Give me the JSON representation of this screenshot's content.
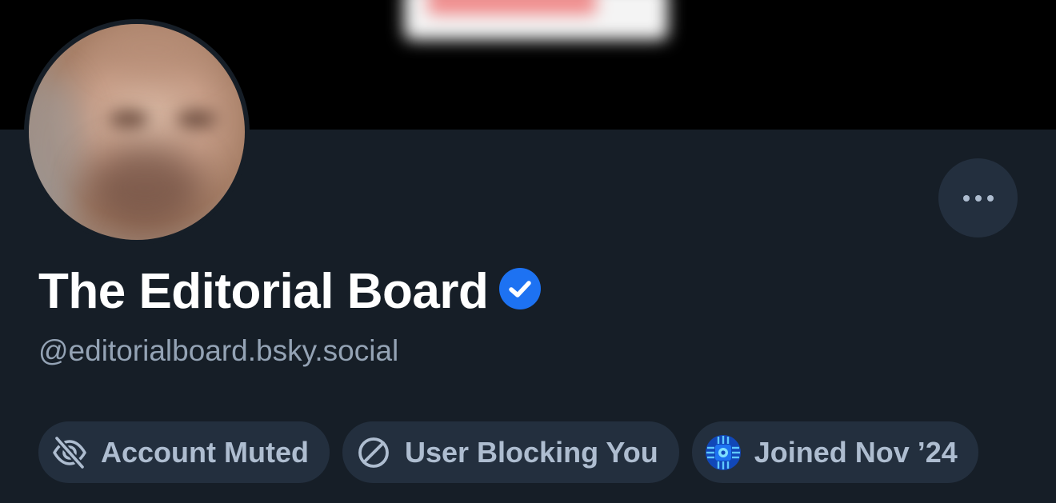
{
  "profile": {
    "display_name": "The Editorial Board",
    "handle": "@editorialboard.bsky.social",
    "verified": true
  },
  "actions": {
    "more_icon": "more-horizontal-icon"
  },
  "badges": [
    {
      "label": "Account Muted",
      "icon": "eye-slash-icon"
    },
    {
      "label": "User Blocking You",
      "icon": "block-icon"
    },
    {
      "label": "Joined Nov ’24",
      "icon": "starter-pack-icon"
    }
  ],
  "colors": {
    "background": "#161e27",
    "banner": "#000000",
    "pill_bg": "#232f3e",
    "pill_text": "#aebdd0",
    "handle_text": "#94a3b5",
    "verified_blue": "#1d72f2",
    "name_text": "#ffffff"
  }
}
